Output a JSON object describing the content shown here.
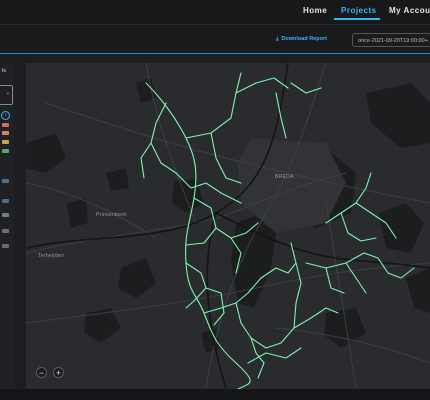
{
  "nav": {
    "items": [
      {
        "label": "Home",
        "active": false
      },
      {
        "label": "Projects",
        "active": true
      },
      {
        "label": "My Account",
        "active": false
      }
    ],
    "accent": "#38b6f0"
  },
  "toolbar": {
    "download_icon": "download-icon",
    "download_label": "Download Report",
    "date_value": "once-2021-09-20T19:00:00+..."
  },
  "left_panel": {
    "label": "ls",
    "info_icon": "info-icon",
    "chevron_icon": "chevron-down-icon",
    "swatch_colors": [
      "#d46a6a",
      "#d08a57",
      "#c9a64f",
      "#58a86a",
      "#4d6f8f",
      "#536b84",
      "#6b7e93",
      "#7c6580",
      "#7b6076"
    ]
  },
  "map": {
    "city_label": "BREDA",
    "place_labels": [
      "Prinsenbeek",
      "Terheijden"
    ],
    "network_color": "#7df5b0",
    "zoom_out_label": "−",
    "zoom_in_label": "+"
  }
}
